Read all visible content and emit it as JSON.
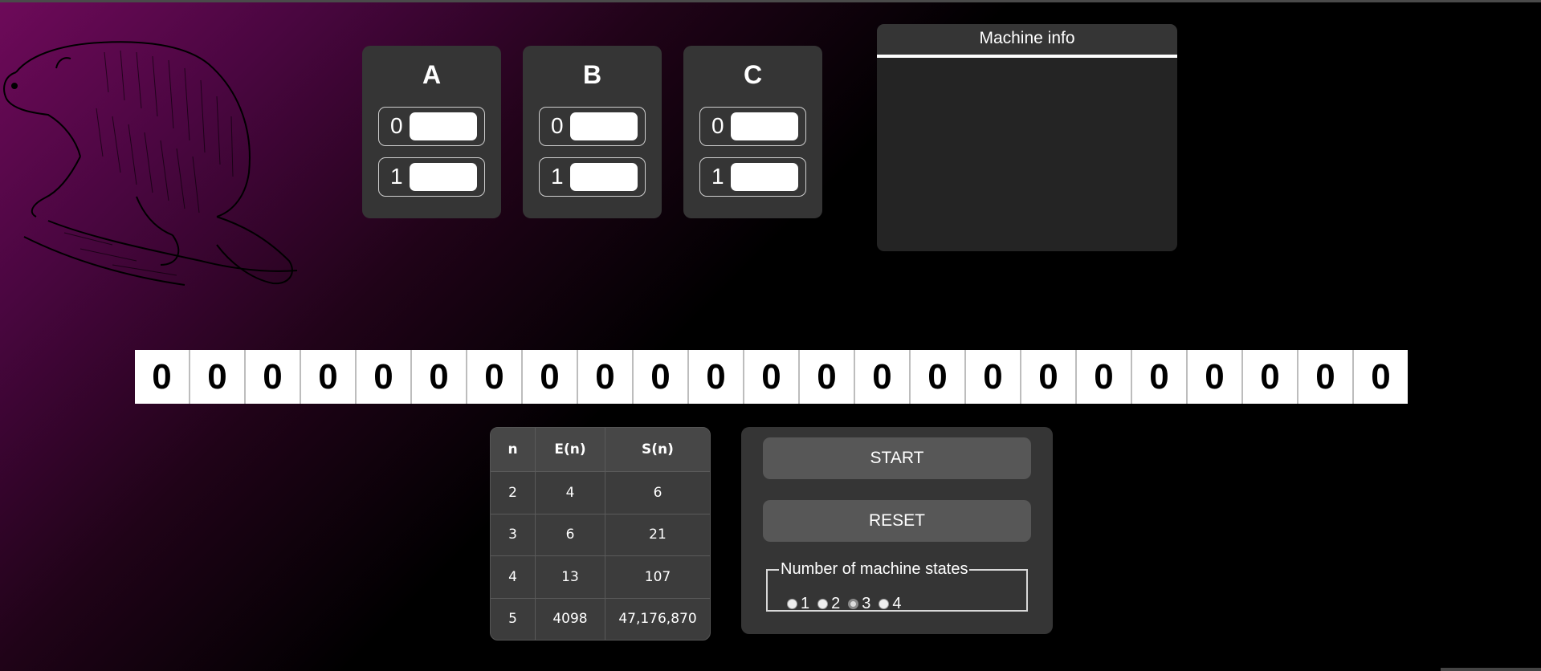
{
  "states": [
    {
      "name": "A",
      "rows": [
        {
          "label": "0",
          "value": ""
        },
        {
          "label": "1",
          "value": ""
        }
      ]
    },
    {
      "name": "B",
      "rows": [
        {
          "label": "0",
          "value": ""
        },
        {
          "label": "1",
          "value": ""
        }
      ]
    },
    {
      "name": "C",
      "rows": [
        {
          "label": "0",
          "value": ""
        },
        {
          "label": "1",
          "value": ""
        }
      ]
    }
  ],
  "machine_info": {
    "title": "Machine info",
    "content": ""
  },
  "tape": [
    "0",
    "0",
    "0",
    "0",
    "0",
    "0",
    "0",
    "0",
    "0",
    "0",
    "0",
    "0",
    "0",
    "0",
    "0",
    "0",
    "0",
    "0",
    "0",
    "0",
    "0",
    "0",
    "0"
  ],
  "table": {
    "headers": [
      "n",
      "E(n)",
      "S(n)"
    ],
    "rows": [
      [
        "2",
        "4",
        "6"
      ],
      [
        "3",
        "6",
        "21"
      ],
      [
        "4",
        "13",
        "107"
      ],
      [
        "5",
        "4098",
        "47,176,870"
      ]
    ]
  },
  "controls": {
    "start_label": "START",
    "reset_label": "RESET",
    "states_legend": "Number of machine states",
    "state_options": [
      "1",
      "2",
      "3",
      "4"
    ],
    "selected_states": "3"
  },
  "colors": {
    "accent": "#6e0a5a",
    "panel": "#353535"
  }
}
